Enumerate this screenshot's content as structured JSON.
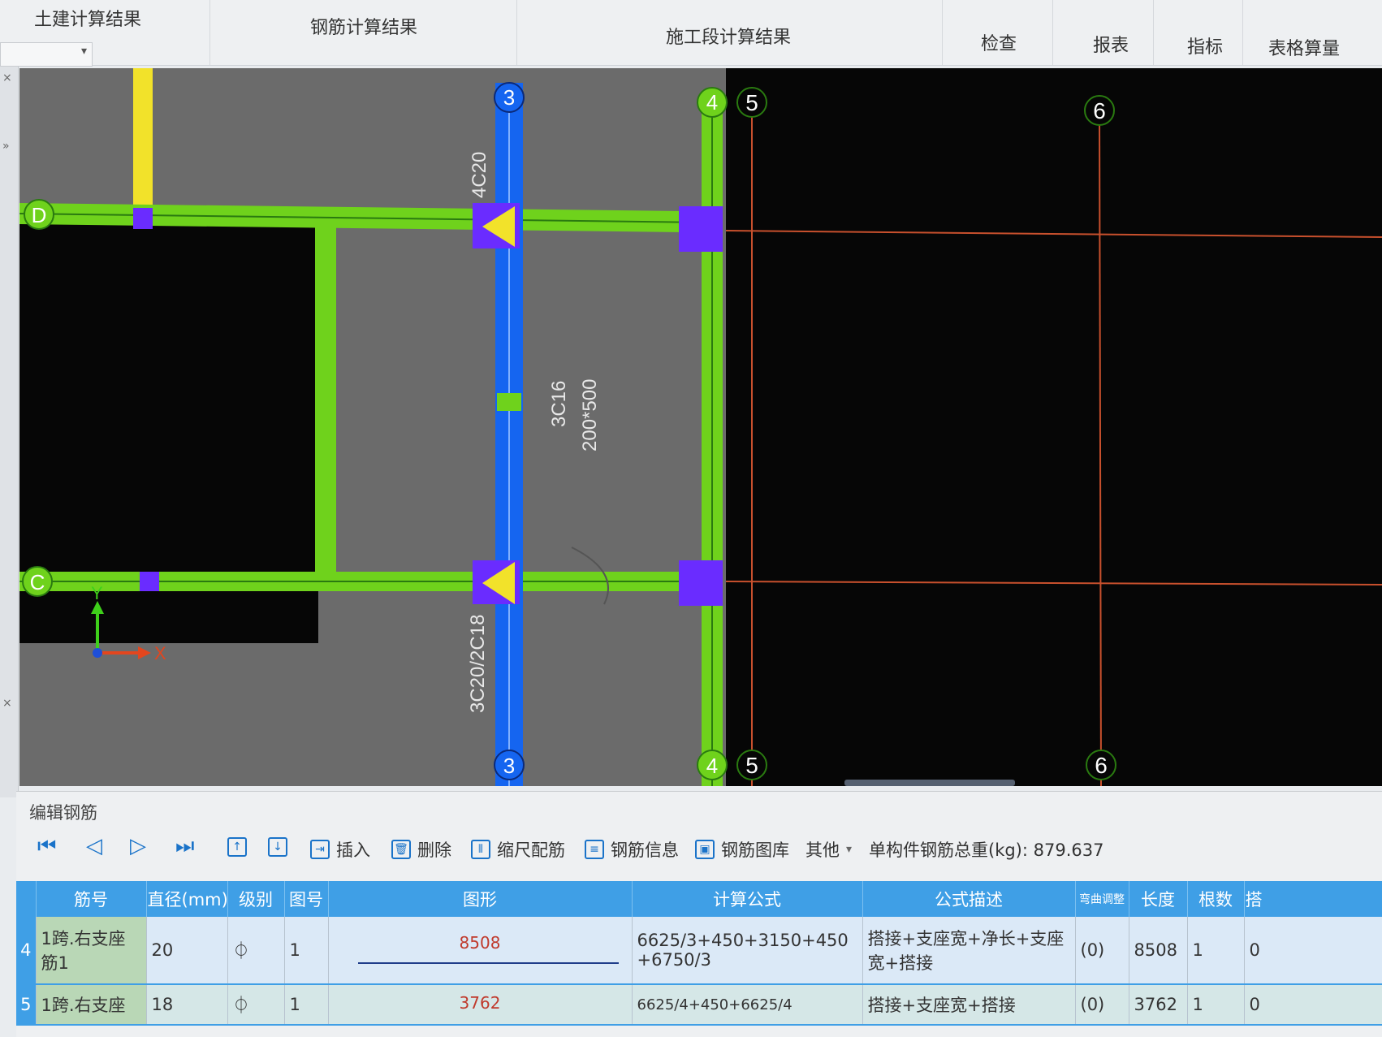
{
  "tabs": [
    "土建计算结果",
    "钢筋计算结果",
    "施工段计算结果",
    "检查",
    "报表",
    "指标",
    "表格算量"
  ],
  "canvas": {
    "axis_labels": {
      "top": [
        "3",
        "4",
        "5",
        "6"
      ],
      "bottom": [
        "3",
        "4",
        "5",
        "6"
      ],
      "left": [
        "D",
        "C"
      ]
    },
    "annotations": {
      "beam_top": "4C20",
      "beam_mid_1": "3C16",
      "beam_mid_2": "200*500",
      "beam_bottom": "3C20/2C18"
    },
    "coord": {
      "y": "Y",
      "x": "X"
    }
  },
  "editor": {
    "title": "编辑钢筋",
    "toolbar": {
      "insert": "插入",
      "delete": "删除",
      "scale": "缩尺配筋",
      "info": "钢筋信息",
      "library": "钢筋图库",
      "other": "其他",
      "total": "单构件钢筋总重(kg): 879.637"
    },
    "columns": [
      "筋号",
      "直径(mm)",
      "级别",
      "图号",
      "图形",
      "计算公式",
      "公式描述",
      "弯曲调整",
      "长度",
      "根数",
      "搭"
    ],
    "rows": [
      {
        "no": "4",
        "name": "1跨.右支座筋1",
        "dia": "20",
        "grade": "⏀",
        "fig": "1",
        "shape_value": "8508",
        "formula": "6625/3+450+3150+450+6750/3",
        "desc": "搭接+支座宽+净长+支座宽+搭接",
        "bend": "(0)",
        "length": "8508",
        "count": "1",
        "lap": "0"
      },
      {
        "no": "5",
        "name": "1跨.右支座",
        "dia": "18",
        "grade": "⏀",
        "fig": "1",
        "shape_value": "3762",
        "formula": "6625/4+450+6625/4",
        "desc": "搭接+支座宽+搭接",
        "bend": "(0)",
        "length": "3762",
        "count": "1",
        "lap": "0"
      }
    ]
  },
  "colors": {
    "beam_green": "#6fd21c",
    "beam_blue": "#1565f0",
    "beam_yellow": "#f2e22a",
    "column_purple": "#6a2cff",
    "header_blue": "#3f9fe6",
    "axis_red": "#c8502d"
  }
}
